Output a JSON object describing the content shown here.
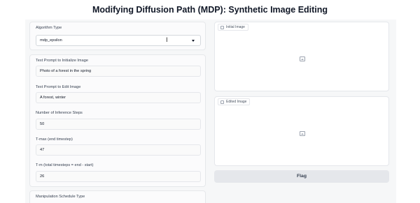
{
  "header": {
    "title": "Modifying Diffusion Path (MDP): Synthetic Image Editing"
  },
  "algorithm": {
    "label": "Algorithm Type",
    "value": "mdp_epsilon"
  },
  "prompt_init": {
    "label": "Text Prompt to Initialize Image",
    "value": "Photo of a forest in the spring"
  },
  "prompt_edit": {
    "label": "Text Prompt to Edit Image",
    "value": "A forest, winter"
  },
  "steps": {
    "label": "Number of Inference Steps",
    "value": "50"
  },
  "tmax": {
    "label": "T-max (end timestep)",
    "value": "47"
  },
  "tm": {
    "label": "T-m (total timesteps = end - start)",
    "value": "26"
  },
  "schedule": {
    "label": "Manipulation Schedule Type"
  },
  "initial_image": {
    "label": "Initial Image",
    "icon": "image-icon"
  },
  "edited_image": {
    "label": "Edited Image",
    "icon": "image-icon"
  },
  "actions": {
    "flag_label": "Flag"
  }
}
